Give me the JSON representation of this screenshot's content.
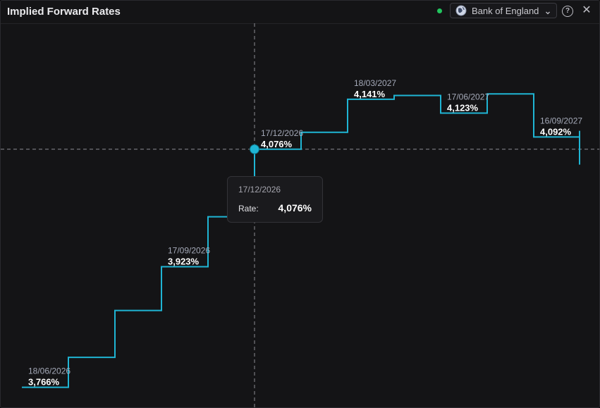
{
  "header": {
    "title": "Implied Forward Rates",
    "source_label": "Bank of England",
    "status_color": "#22c55e",
    "source_icon": "globe-icon",
    "dropdown_icon": "chevron-down-icon",
    "help_icon": "help-icon",
    "close_icon": "close-icon"
  },
  "tooltip": {
    "date": "17/12/2026",
    "label": "Rate:",
    "value": "4,076%"
  },
  "chart_data": {
    "type": "line",
    "style": "step",
    "line_color": "#1fb5d4",
    "xlabel": "",
    "ylabel": "",
    "grid": false,
    "series": [
      {
        "values": [
          3.766,
          3.805,
          3.866,
          3.923,
          3.988,
          4.076,
          4.098,
          4.141,
          4.146,
          4.123,
          4.148,
          4.092,
          4.1
        ]
      }
    ],
    "labels": [
      {
        "index": 0,
        "date": "18/06/2026",
        "value": "3,766%"
      },
      {
        "index": 3,
        "date": "17/09/2026",
        "value": "3,923%"
      },
      {
        "index": 5,
        "date": "17/12/2026",
        "value": "4,076%"
      },
      {
        "index": 7,
        "date": "18/03/2027",
        "value": "4,141%"
      },
      {
        "index": 9,
        "date": "17/06/2027",
        "value": "4,123%"
      },
      {
        "index": 11,
        "date": "16/09/2027",
        "value": "4,092%"
      }
    ],
    "crosshair_index": 5,
    "ylim": [
      3.74,
      4.24
    ]
  }
}
